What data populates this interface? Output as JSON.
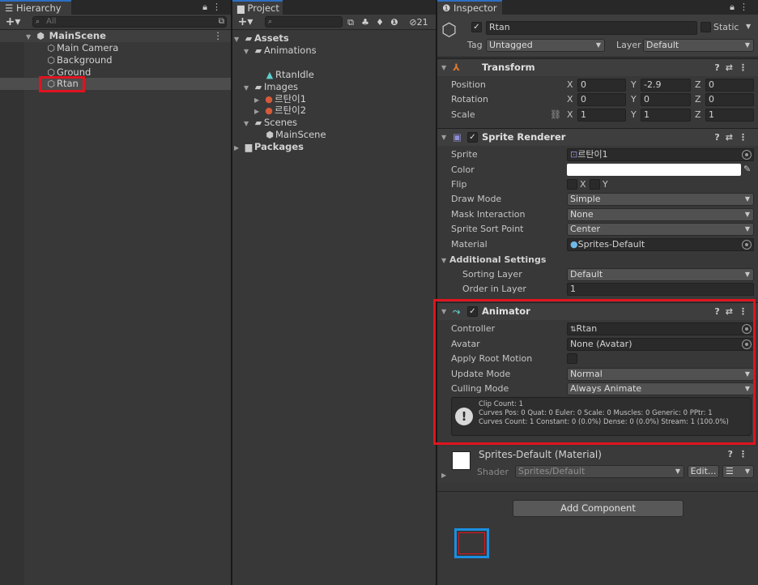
{
  "hierarchy": {
    "tab_label": "Hierarchy",
    "search_placeholder": "All",
    "scene_name": "MainScene",
    "items": [
      "Main Camera",
      "Background",
      "Ground",
      "Rtan"
    ]
  },
  "project": {
    "tab_label": "Project",
    "hidden_count": "21",
    "tree": {
      "assets": "Assets",
      "animations": "Animations",
      "clip": "RtanIdle",
      "images": "Images",
      "image1": "르탄이1",
      "image2": "르탄이2",
      "scenes": "Scenes",
      "scene_file": "MainScene",
      "packages": "Packages"
    }
  },
  "inspector": {
    "tab_label": "Inspector",
    "object_name": "Rtan",
    "static_label": "Static",
    "tag_label": "Tag",
    "tag_value": "Untagged",
    "layer_label": "Layer",
    "layer_value": "Default",
    "transform": {
      "title": "Transform",
      "position_label": "Position",
      "rotation_label": "Rotation",
      "scale_label": "Scale",
      "axis_x": "X",
      "axis_y": "Y",
      "axis_z": "Z",
      "position": [
        "0",
        "-2.9",
        "0"
      ],
      "rotation": [
        "0",
        "0",
        "0"
      ],
      "scale": [
        "1",
        "1",
        "1"
      ]
    },
    "sprite_renderer": {
      "title": "Sprite Renderer",
      "sprite_label": "Sprite",
      "sprite_value": "르탄이1",
      "color_label": "Color",
      "color_value": "#ffffff",
      "flip_label": "Flip",
      "flip_x": "X",
      "flip_y": "Y",
      "draw_mode_label": "Draw Mode",
      "draw_mode_value": "Simple",
      "mask_label": "Mask Interaction",
      "mask_value": "None",
      "sort_point_label": "Sprite Sort Point",
      "sort_point_value": "Center",
      "material_label": "Material",
      "material_value": "Sprites-Default",
      "additional_label": "Additional Settings",
      "sorting_layer_label": "Sorting Layer",
      "sorting_layer_value": "Default",
      "order_label": "Order in Layer",
      "order_value": "1"
    },
    "animator": {
      "title": "Animator",
      "controller_label": "Controller",
      "controller_value": "Rtan",
      "avatar_label": "Avatar",
      "avatar_value": "None (Avatar)",
      "root_motion_label": "Apply Root Motion",
      "update_mode_label": "Update Mode",
      "update_mode_value": "Normal",
      "culling_label": "Culling Mode",
      "culling_value": "Always Animate",
      "help_lines": [
        "Clip Count: 1",
        "Curves Pos: 0 Quat: 0 Euler: 0 Scale: 0 Muscles: 0 Generic: 0 PPtr: 1",
        "Curves Count: 1 Constant: 0 (0.0%) Dense: 0 (0.0%) Stream: 1 (100.0%)"
      ]
    },
    "material": {
      "title": "Sprites-Default (Material)",
      "shader_label": "Shader",
      "shader_value": "Sprites/Default",
      "edit_label": "Edit..."
    },
    "add_component_label": "Add Component"
  },
  "colors": {
    "highlight_red": "#e0141f",
    "highlight_blue": "#1a8fe0",
    "selection": "#4d4d4d"
  }
}
